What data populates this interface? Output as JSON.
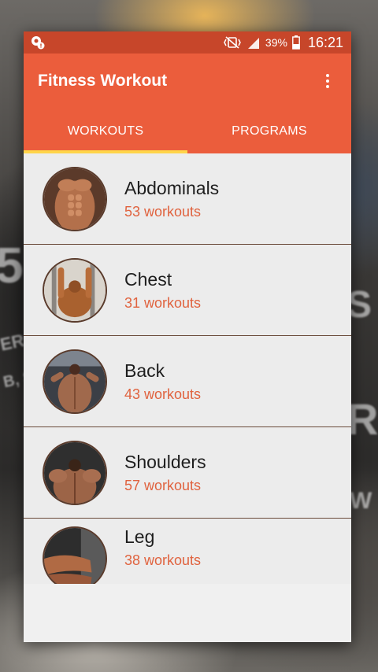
{
  "status_bar": {
    "battery": "39%",
    "time": "16:21",
    "icons": [
      "notification-icon",
      "vibrate-icon",
      "signal-icon",
      "battery-icon"
    ]
  },
  "app_bar": {
    "title": "Fitness Workout",
    "menu_icon": "more-vert-icon"
  },
  "tabs": [
    {
      "label": "WORKOUTS",
      "active": true
    },
    {
      "label": "PROGRAMS",
      "active": false
    }
  ],
  "categories": [
    {
      "name": "Abdominals",
      "count": "53 workouts"
    },
    {
      "name": "Chest",
      "count": "31 workouts"
    },
    {
      "name": "Back",
      "count": "43 workouts"
    },
    {
      "name": "Shoulders",
      "count": "57 workouts"
    },
    {
      "name": "Leg",
      "count": "38 workouts"
    }
  ],
  "colors": {
    "status_bar": "#c7462a",
    "primary": "#eb5d3c",
    "tab_indicator": "#ffd54a",
    "count_text": "#e0633f",
    "list_background": "#ececec"
  }
}
